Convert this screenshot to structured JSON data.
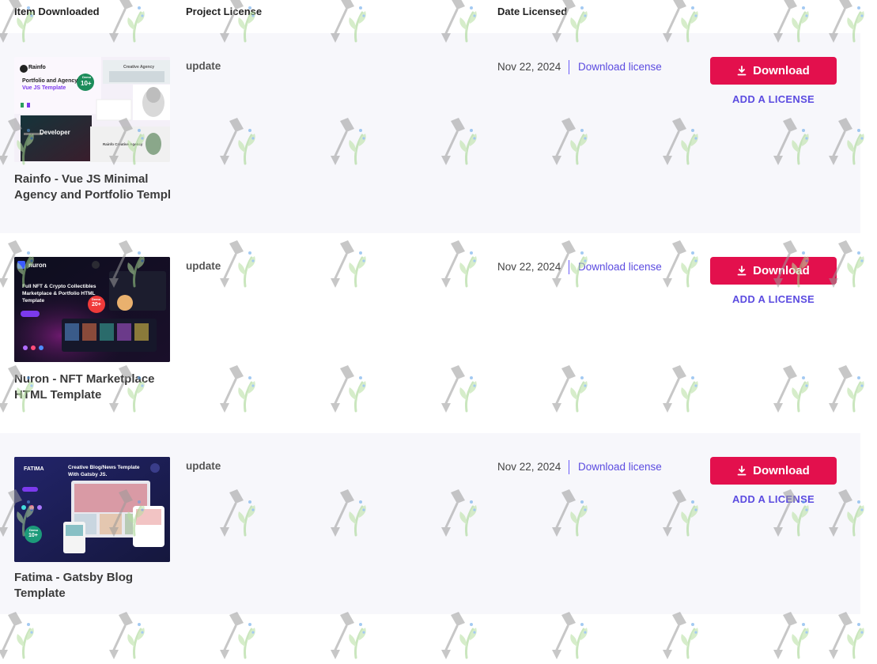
{
  "table": {
    "headers": {
      "item": "Item Downloaded",
      "license": "Project License",
      "date": "Date Licensed"
    },
    "rows": [
      {
        "title": "Rainfo - Vue JS Minimal Agency and Portfolio Templ",
        "license": "update",
        "date": "Nov 22, 2024",
        "download_license": "Download license",
        "download_button": "Download",
        "add_license": "ADD A LICENSE",
        "thumb": {
          "brand": "Rainfo",
          "line1": "Portfolio and Agency",
          "line2": "Vue JS Template",
          "badge": "10+",
          "badge_label": "Demo",
          "tag": "Creative Agency",
          "hero": "Developer",
          "sub": "Rainfo Creative Agency"
        }
      },
      {
        "title": "Nuron - NFT Marketplace HTML Template",
        "license": "update",
        "date": "Nov 22, 2024",
        "download_license": "Download license",
        "download_button": "Download",
        "add_license": "ADD A LICENSE",
        "thumb": {
          "brand": "nuron",
          "line1": "Full NFT & Crypto Collectibles",
          "line2": "Marketplace & Portfolio HTML",
          "line3": "Template",
          "badge": "20+",
          "badge_label": "Demo"
        }
      },
      {
        "title": "Fatima - Gatsby Blog Template",
        "license": "update",
        "date": "Nov 22, 2024",
        "download_license": "Download license",
        "download_button": "Download",
        "add_license": "ADD A LICENSE",
        "thumb": {
          "brand": "FATIMA",
          "line1": "Creative Blog/News Template",
          "line2": "With Gatsby JS.",
          "badge": "10+",
          "badge_label": "Demo"
        }
      }
    ]
  },
  "colors": {
    "download_button": "#e3104d",
    "link": "#5b4be0",
    "row_shade": "#f7f7fb"
  },
  "icons": {
    "download": "download-icon",
    "watermark": "shovel-plant-watermark-icon"
  }
}
